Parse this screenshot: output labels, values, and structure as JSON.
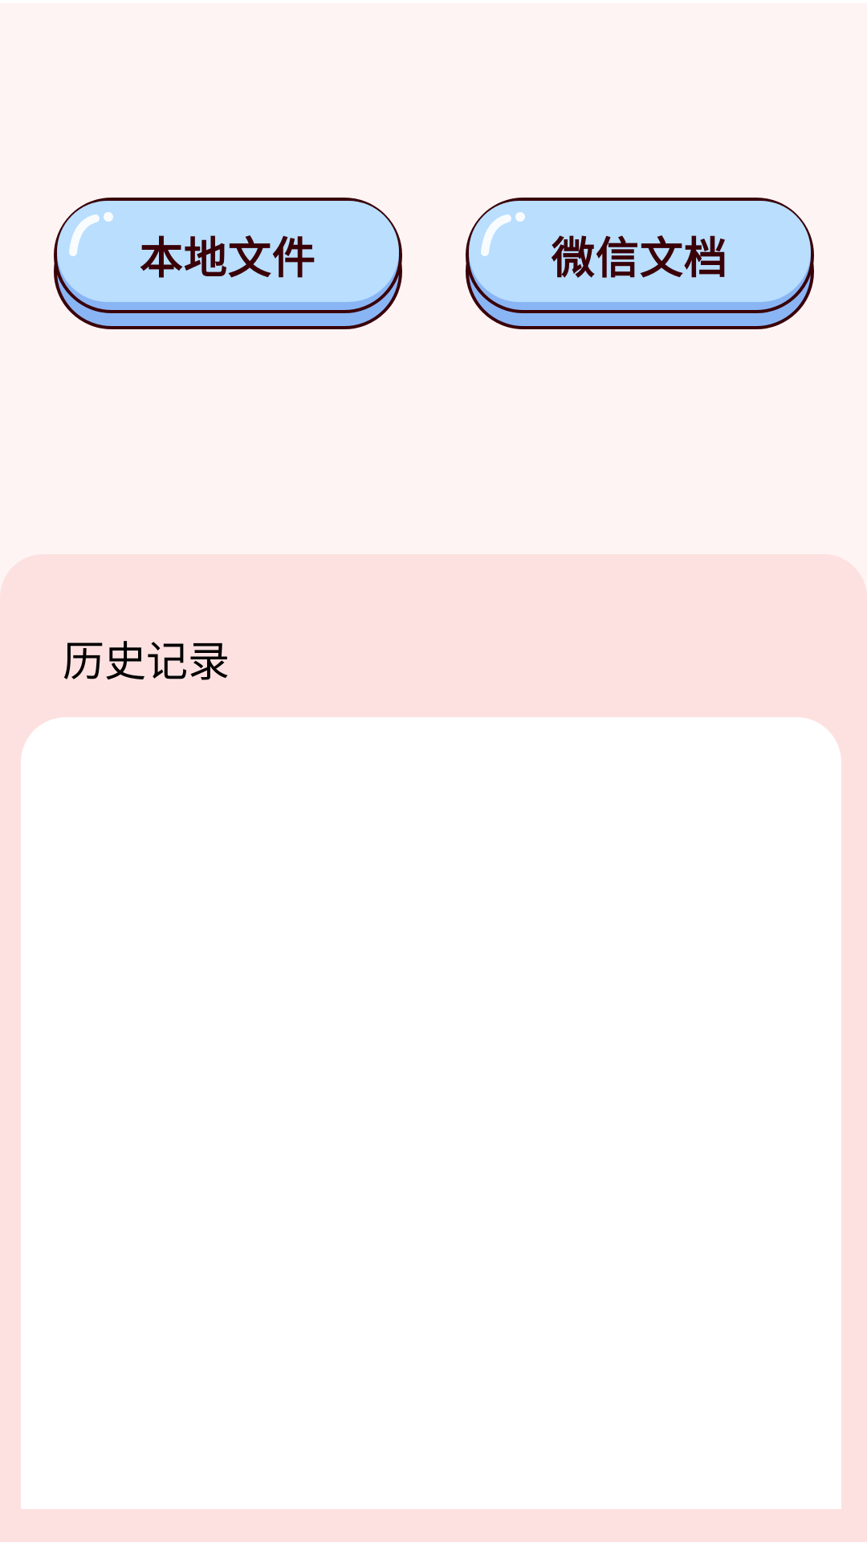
{
  "buttons": {
    "local_file": "本地文件",
    "wechat_doc": "微信文档"
  },
  "history": {
    "title": "历史记录",
    "items": []
  },
  "colors": {
    "background": "#fef4f4",
    "panel": "#fde1e1",
    "button_face": "#b9defe",
    "button_base": "#8ab5f5",
    "button_outline": "#3a0008",
    "button_text": "#3a0008",
    "list_background": "#ffffff"
  }
}
